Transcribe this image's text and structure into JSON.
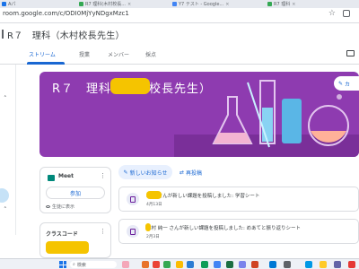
{
  "browser": {
    "tabs": [
      {
        "label": "Aパ"
      },
      {
        "label": "R7 理科(木村校長..."
      },
      {
        "label": "Y7 テスト - Google..."
      },
      {
        "label": "R7 理科"
      }
    ],
    "url": "room.google.com/c/ODI0MjYyNDgxMzc1"
  },
  "app": {
    "class_title": "R７　理科（木村校長先生）",
    "tabs": [
      {
        "label": "ストリーム"
      },
      {
        "label": "授業"
      },
      {
        "label": "メンバー"
      },
      {
        "label": "採点"
      }
    ]
  },
  "banner": {
    "title": "R７　理科（木村校長先生）",
    "customize_label": "カ"
  },
  "meet": {
    "label": "Meet",
    "join_label": "参加",
    "visibility_label": "生徒に表示"
  },
  "class_code": {
    "label": "クラスコード"
  },
  "stream": {
    "announce_label": "新しいお知らせ",
    "repost_label": "再投稿",
    "posts": [
      {
        "text": "木村 さんが新しい課題を投稿しました: 学習シート",
        "date": "4月13日"
      },
      {
        "text": "木村 純一 さんが新しい課題を投稿しました: めあてと振り返りシート",
        "date": "2月3日"
      }
    ]
  },
  "taskbar": {
    "search_placeholder": "検索"
  },
  "colors": {
    "accent": "#1967d2",
    "banner": "#8e3bb0",
    "redaction": "#f5c400"
  }
}
